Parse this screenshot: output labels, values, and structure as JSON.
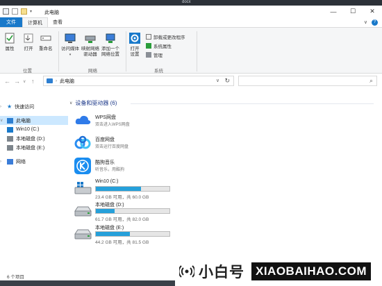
{
  "titlebar": {
    "doc_label": "docx",
    "title": "此电脑",
    "minimize": "—",
    "maximize": "☐",
    "close": "✕"
  },
  "tabs": [
    {
      "label": "文件"
    },
    {
      "label": "计算机"
    },
    {
      "label": "查看"
    }
  ],
  "ribbon": {
    "location_group": {
      "label": "位置",
      "buttons": [
        {
          "label": "属性",
          "icon": "properties-icon"
        },
        {
          "label": "打开",
          "icon": "open-icon"
        },
        {
          "label": "重命名",
          "icon": "rename-icon"
        }
      ]
    },
    "network_group": {
      "label": "网络",
      "buttons": [
        {
          "label": "访问媒体",
          "icon": "media-icon"
        },
        {
          "label": "映射网络\n驱动器",
          "icon": "map-drive-icon"
        },
        {
          "label": "添加一个\n网络位置",
          "icon": "add-network-location-icon"
        }
      ]
    },
    "system_group": {
      "label": "系统",
      "open_settings": {
        "label": "打开\n设置",
        "icon": "gear-icon"
      },
      "items": [
        {
          "label": "卸载或更改程序",
          "icon": "uninstall-icon"
        },
        {
          "label": "系统属性",
          "icon": "system-properties-icon"
        },
        {
          "label": "管理",
          "icon": "manage-icon"
        }
      ]
    }
  },
  "address": {
    "path": "此电脑",
    "back": "←",
    "forward": "→",
    "up": "↑",
    "refresh": "↻",
    "dropdown": "∨",
    "search_icon": "⌕"
  },
  "nav": {
    "items": [
      {
        "label": "快速访问",
        "icon": "star-icon"
      },
      {
        "label": "此电脑",
        "icon": "pc-icon"
      },
      {
        "label": "Win10 (C:)",
        "icon": "windows-drive-icon"
      },
      {
        "label": "本地磁盘 (D:)",
        "icon": "drive-icon"
      },
      {
        "label": "本地磁盘 (E:)",
        "icon": "drive-icon"
      },
      {
        "label": "网络",
        "icon": "network-icon"
      }
    ]
  },
  "content": {
    "section_title": "设备和驱动器 (6)",
    "clouds": [
      {
        "name": "WPS网盘",
        "desc": "双击进入WPS网盘",
        "icon": "wps-cloud-icon"
      },
      {
        "name": "百度网盘",
        "desc": "双击运行百度网盘",
        "icon": "baidu-cloud-icon"
      },
      {
        "name": "酷狗音乐",
        "desc": "听音乐，用酷狗",
        "icon": "kugou-icon"
      }
    ],
    "drives": [
      {
        "name": "Win10 (C:)",
        "space": "23.4 GB 可用，共 60.0 GB",
        "used_fraction": 0.61,
        "icon": "windows-drive-icon"
      },
      {
        "name": "本地磁盘 (D:)",
        "space": "61.7 GB 可用，共 82.0 GB",
        "used_fraction": 0.25,
        "icon": "drive-icon"
      },
      {
        "name": "本地磁盘 (E:)",
        "space": "44.2 GB 可用，共 81.5 GB",
        "used_fraction": 0.46,
        "icon": "drive-icon"
      }
    ]
  },
  "status": {
    "count": "6 个项目"
  },
  "watermark": {
    "name": "小白号",
    "url": "XIAOBAIHAO.COM"
  },
  "colors": {
    "accent": "#1979ca",
    "bar": "#26a0da",
    "selection": "#cce8ff"
  }
}
